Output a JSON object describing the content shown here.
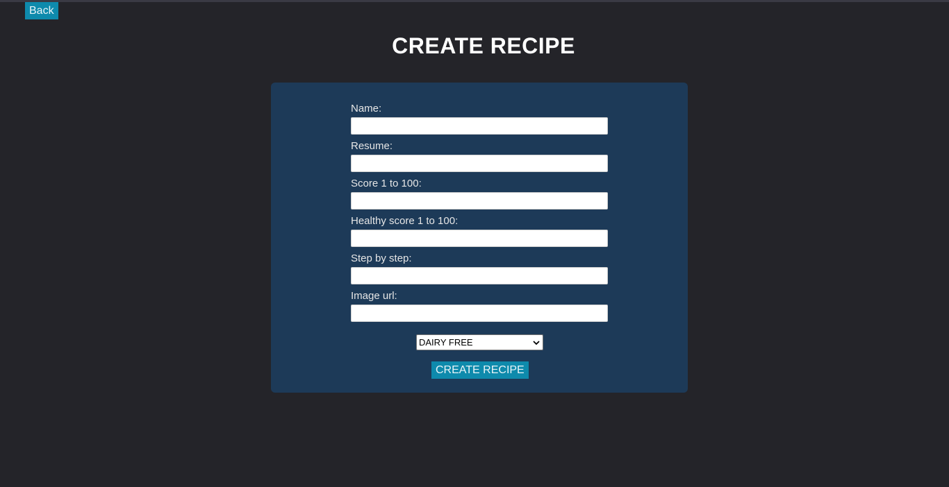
{
  "header": {
    "back_label": "Back",
    "title": "CREATE RECIPE"
  },
  "form": {
    "fields": [
      {
        "label": "Name:",
        "value": "",
        "placeholder": ""
      },
      {
        "label": "Resume:",
        "value": "",
        "placeholder": ""
      },
      {
        "label": "Score 1 to 100:",
        "value": "",
        "placeholder": ""
      },
      {
        "label": "Healthy score 1 to 100:",
        "value": "",
        "placeholder": ""
      },
      {
        "label": "Step by step:",
        "value": "",
        "placeholder": ""
      },
      {
        "label": "Image url:",
        "value": "",
        "placeholder": ""
      }
    ],
    "diet_select": {
      "selected": "DAIRY FREE"
    },
    "submit_label": "CREATE RECIPE"
  },
  "colors": {
    "background": "#242429",
    "card": "#1d3a58",
    "button": "#0e8aac"
  },
  "icons": {
    "select_arrow": "chevron-down-icon"
  }
}
